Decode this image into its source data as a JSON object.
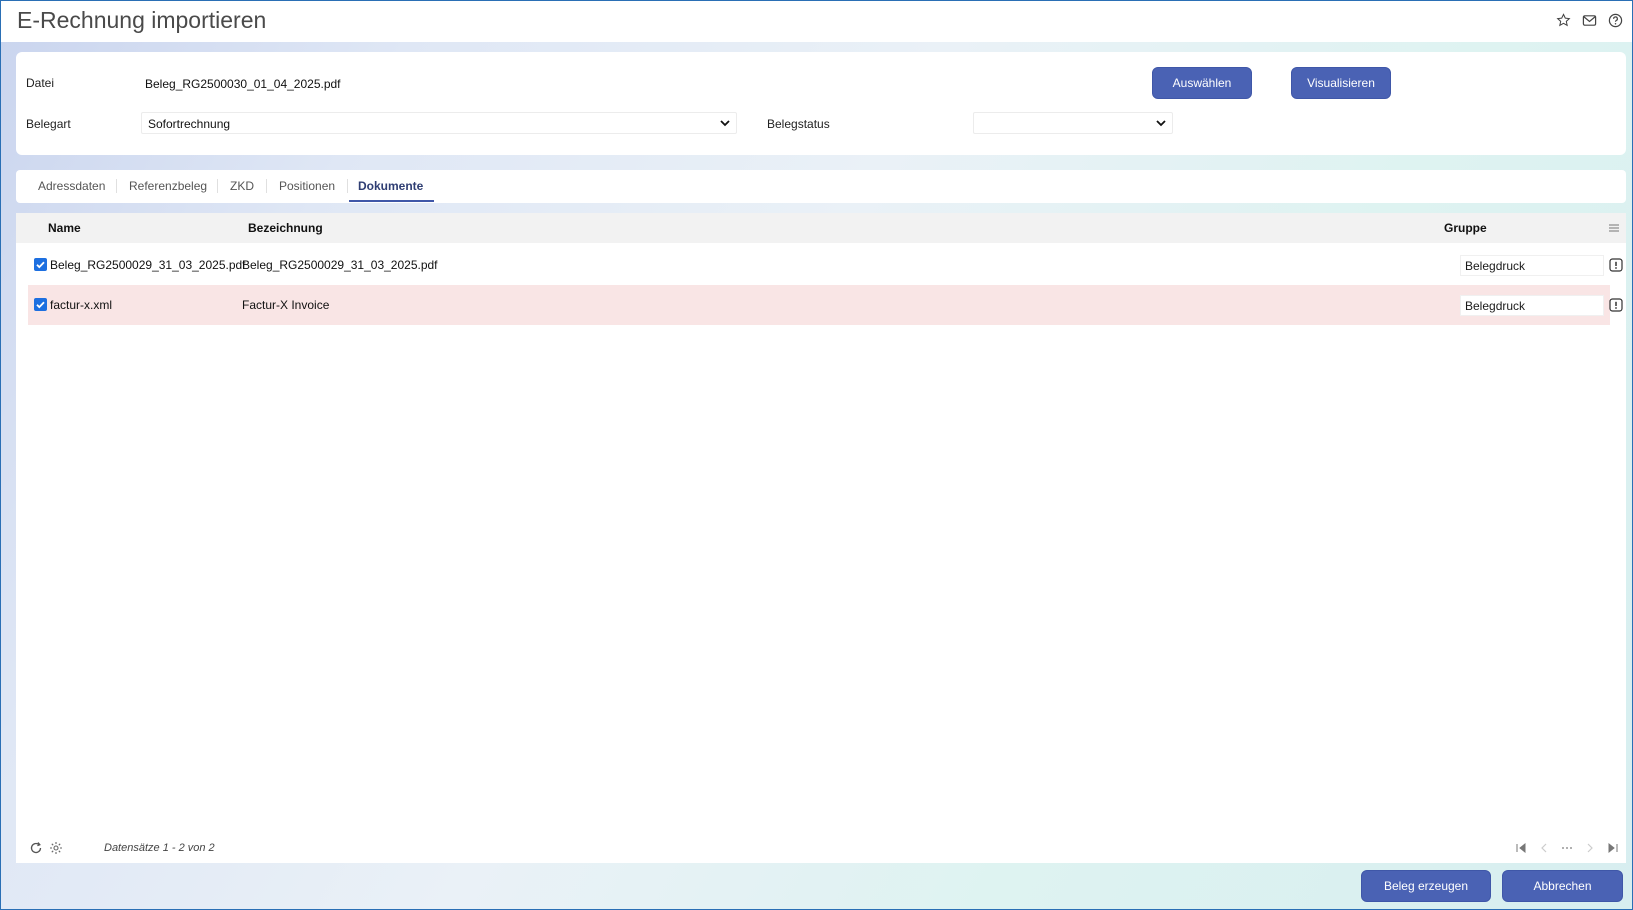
{
  "window": {
    "title": "E-Rechnung importieren"
  },
  "header_icons": [
    "star-icon",
    "mail-icon",
    "help-icon"
  ],
  "form": {
    "datei_label": "Datei",
    "datei_value": "Beleg_RG2500030_01_04_2025.pdf",
    "belegart_label": "Belegart",
    "belegart_value": "Sofortrechnung",
    "belegstatus_label": "Belegstatus",
    "belegstatus_value": "",
    "select_button": "Auswählen",
    "visualize_button": "Visualisieren"
  },
  "tabs": [
    {
      "label": "Adressdaten",
      "active": false
    },
    {
      "label": "Referenzbeleg",
      "active": false
    },
    {
      "label": "ZKD",
      "active": false
    },
    {
      "label": "Positionen",
      "active": false
    },
    {
      "label": "Dokumente",
      "active": true
    }
  ],
  "grid": {
    "columns": {
      "name": "Name",
      "bezeichnung": "Bezeichnung",
      "gruppe": "Gruppe"
    },
    "rows": [
      {
        "checked": true,
        "name": "Beleg_RG2500029_31_03_2025.pdf",
        "bezeichnung": "Beleg_RG2500029_31_03_2025.pdf",
        "gruppe": "Belegdruck"
      },
      {
        "checked": true,
        "name": "factur-x.xml",
        "bezeichnung": "Factur-X Invoice",
        "gruppe": "Belegdruck"
      }
    ],
    "footer_text": "Datensätze 1 - 2 von 2"
  },
  "actions": {
    "create_button": "Beleg erzeugen",
    "cancel_button": "Abbrechen"
  },
  "colors": {
    "accent": "#4a62b4",
    "row_highlight": "#f9e5e5",
    "checkbox": "#1d6fe0"
  }
}
